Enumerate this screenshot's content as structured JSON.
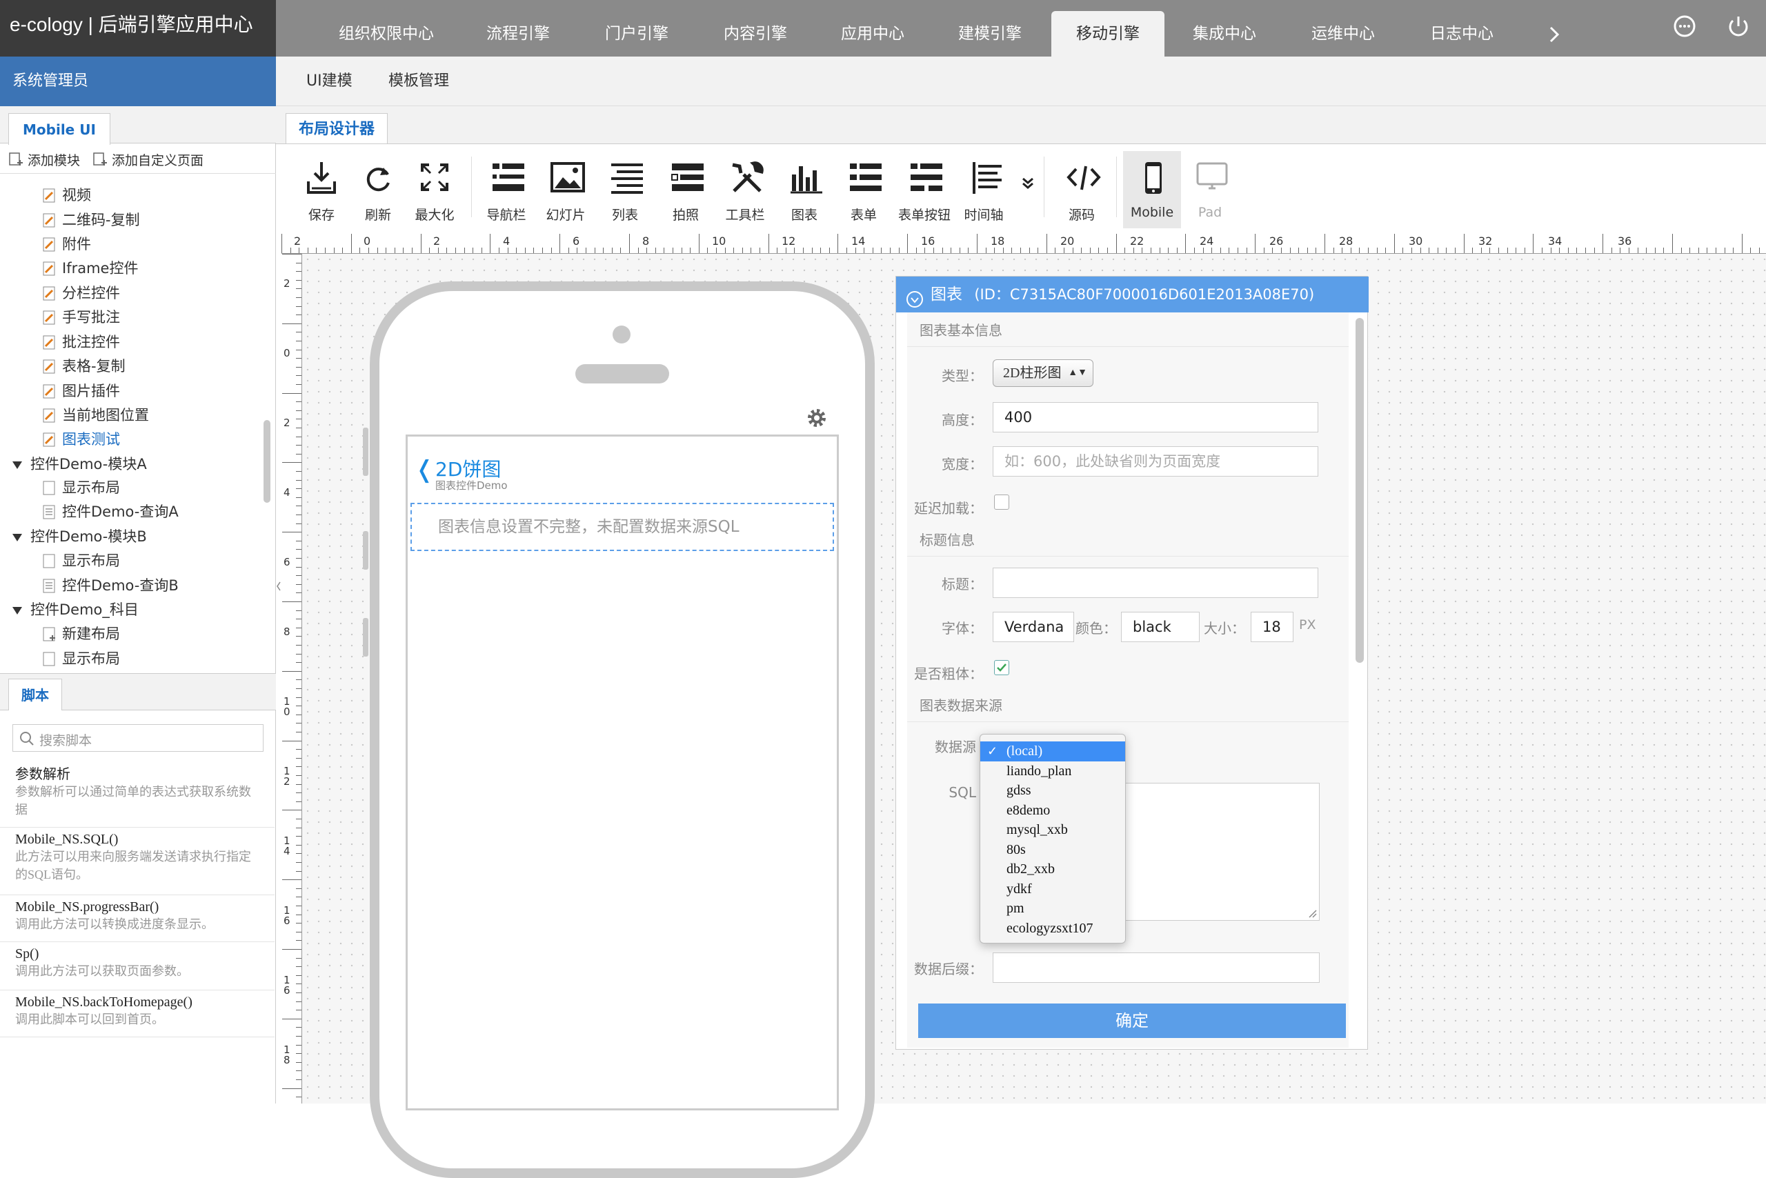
{
  "app": {
    "title": "e-cology | 后端引擎应用中心"
  },
  "nav": {
    "tabs": [
      {
        "label": "组织权限中心"
      },
      {
        "label": "流程引擎"
      },
      {
        "label": "门户引擎"
      },
      {
        "label": "内容引擎"
      },
      {
        "label": "应用中心"
      },
      {
        "label": "建模引擎"
      },
      {
        "label": "移动引擎"
      },
      {
        "label": "集成中心"
      },
      {
        "label": "运维中心"
      },
      {
        "label": "日志中心"
      }
    ],
    "active": "移动引擎",
    "more_icon": "chevron-right-icon",
    "menu_icon": "more-circle-icon",
    "power_icon": "power-icon"
  },
  "user": {
    "name": "系统管理员"
  },
  "subnav": {
    "items": [
      {
        "label": "UI建模"
      },
      {
        "label": "模板管理"
      }
    ]
  },
  "leftpanel": {
    "tab": "Mobile UI",
    "actions": [
      {
        "label": "添加模块"
      },
      {
        "label": "添加自定义页面"
      }
    ],
    "tree": [
      {
        "label": "视频"
      },
      {
        "label": "二维码-复制"
      },
      {
        "label": "附件"
      },
      {
        "label": "Iframe控件"
      },
      {
        "label": "分栏控件"
      },
      {
        "label": "手写批注"
      },
      {
        "label": "批注控件"
      },
      {
        "label": "表格-复制"
      },
      {
        "label": "图片插件"
      },
      {
        "label": "当前地图位置"
      },
      {
        "label": "图表测试"
      },
      {
        "label": "控件Demo-模块A"
      },
      {
        "label": "显示布局"
      },
      {
        "label": "控件Demo-查询A"
      },
      {
        "label": "控件Demo-模块B"
      },
      {
        "label": "显示布局"
      },
      {
        "label": "控件Demo-查询B"
      },
      {
        "label": "控件Demo_科目"
      },
      {
        "label": "新建布局"
      },
      {
        "label": "显示布局"
      }
    ],
    "script_tab": "脚本",
    "script_search_placeholder": "搜索脚本",
    "scripts": [
      {
        "title": "参数解析",
        "desc": "参数解析可以通过简单的表达式获取系统数据"
      },
      {
        "title": "Mobile_NS.SQL()",
        "desc": "此方法可以用来向服务端发送请求执行指定的SQL语句。"
      },
      {
        "title": "Mobile_NS.progressBar()",
        "desc": "调用此方法可以转换成进度条显示。"
      },
      {
        "title": "Sp()",
        "desc": "调用此方法可以获取页面参数。"
      },
      {
        "title": "Mobile_NS.backToHomepage()",
        "desc": "调用此脚本可以回到首页。"
      }
    ]
  },
  "designer": {
    "tab": "布局设计器",
    "tools": [
      {
        "label": "保存",
        "icon": "download-icon"
      },
      {
        "label": "刷新",
        "icon": "refresh-icon"
      },
      {
        "label": "最大化",
        "icon": "maximize-icon"
      },
      {
        "label": "导航栏",
        "icon": "navbar-icon"
      },
      {
        "label": "幻灯片",
        "icon": "slideshow-icon"
      },
      {
        "label": "列表",
        "icon": "list-icon"
      },
      {
        "label": "拍照",
        "icon": "photo-icon"
      },
      {
        "label": "工具栏",
        "icon": "tools-icon"
      },
      {
        "label": "图表",
        "icon": "chart-icon"
      },
      {
        "label": "表单",
        "icon": "form-icon"
      },
      {
        "label": "表单按钮",
        "icon": "form-button-icon"
      },
      {
        "label": "时间轴",
        "icon": "timeline-icon"
      },
      {
        "label": "源码",
        "icon": "code-icon"
      },
      {
        "label": "Mobile",
        "icon": "mobile-icon"
      },
      {
        "label": "Pad",
        "icon": "pad-icon"
      }
    ],
    "ruler_top": [
      "2",
      "0",
      "2",
      "4",
      "6",
      "8",
      "10",
      "12",
      "14",
      "16",
      "18",
      "20",
      "22",
      "24",
      "26",
      "28",
      "30",
      "32",
      "34",
      "36"
    ],
    "ruler_left": [
      "2",
      "0",
      "2",
      "4",
      "6",
      "8",
      "10",
      "12",
      "14",
      "16",
      "16",
      "18"
    ]
  },
  "phone": {
    "page_title": "2D饼图",
    "page_subtitle": "图表控件Demo",
    "placeholder": "图表信息设置不完整，未配置数据来源SQL"
  },
  "chartpanel": {
    "header": "图表",
    "id_text": "(ID：C7315AC80F7000016D601E2013A08E70)",
    "section_basic": "图表基本信息",
    "type_label": "类型：",
    "type_value": "2D柱形图",
    "height_label": "高度：",
    "height_value": "400",
    "width_label": "宽度：",
    "width_placeholder": "如：600，此处缺省则为页面宽度",
    "lazy_label": "延迟加载：",
    "lazy_checked": false,
    "section_title": "标题信息",
    "title_label": "标题：",
    "title_value": "",
    "font_label": "字体：",
    "font_value": "Verdana",
    "color_label": "颜色：",
    "color_value": "black",
    "size_label": "大小：",
    "size_value": "18",
    "size_unit": "PX",
    "bold_label": "是否粗体：",
    "bold_checked": true,
    "section_source": "图表数据来源",
    "source_label": "数据源",
    "sql_label": "SQL",
    "suffix_label": "数据后缀：",
    "ok_label": "确定"
  },
  "dropdown": {
    "selected": "(local)",
    "options": [
      "(local)",
      "liando_plan",
      "gdss",
      "e8demo",
      "mysql_xxb",
      "80s",
      "db2_xxb",
      "ydkf",
      "pm",
      "ecologyzsxt107"
    ]
  },
  "colors": {
    "accent": "#3c74b5",
    "header_blue": "#5b9ee8",
    "link": "#1a6cc1",
    "topbar": "#8a8a8a"
  }
}
